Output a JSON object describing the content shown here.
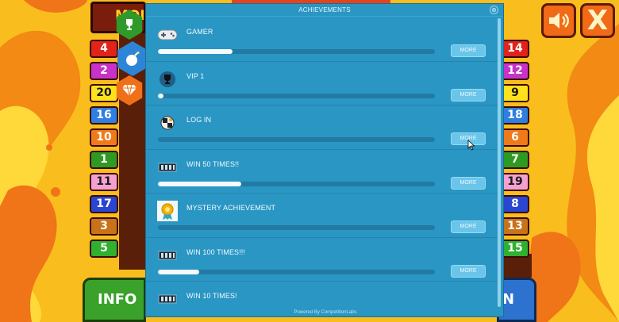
{
  "game": {
    "banner_label": "MONE",
    "info_label": "INFO",
    "spin_label": "N",
    "left_numbers": [
      {
        "value": "4",
        "color": "#e2231a",
        "dark": false
      },
      {
        "value": "2",
        "color": "#c832c8",
        "dark": false
      },
      {
        "value": "20",
        "color": "#ffe21c",
        "dark": true
      },
      {
        "value": "16",
        "color": "#2f7fe0",
        "dark": false
      },
      {
        "value": "10",
        "color": "#f07a1a",
        "dark": false
      },
      {
        "value": "1",
        "color": "#2e9a22",
        "dark": false
      },
      {
        "value": "11",
        "color": "#f5a0d0",
        "dark": true
      },
      {
        "value": "17",
        "color": "#2a46d0",
        "dark": false
      },
      {
        "value": "3",
        "color": "#c8721a",
        "dark": false
      },
      {
        "value": "5",
        "color": "#2fb02f",
        "dark": false
      }
    ],
    "right_numbers": [
      {
        "value": "14",
        "color": "#e2231a",
        "dark": false
      },
      {
        "value": "12",
        "color": "#c832c8",
        "dark": false
      },
      {
        "value": "9",
        "color": "#ffe21c",
        "dark": true
      },
      {
        "value": "18",
        "color": "#2f7fe0",
        "dark": false
      },
      {
        "value": "6",
        "color": "#f07a1a",
        "dark": false
      },
      {
        "value": "7",
        "color": "#2e9a22",
        "dark": false
      },
      {
        "value": "19",
        "color": "#f5a0d0",
        "dark": true
      },
      {
        "value": "8",
        "color": "#2a46d0",
        "dark": false
      },
      {
        "value": "13",
        "color": "#c8721a",
        "dark": false
      },
      {
        "value": "15",
        "color": "#2fb02f",
        "dark": false
      }
    ]
  },
  "modal": {
    "title": "ACHIEVEMENTS",
    "close_glyph": "⊗",
    "footer": "Powered By CompetitionLabs",
    "more_label": "MORE",
    "achievements": [
      {
        "name": "GAMER",
        "progress": 0.27,
        "icon": "gamepad-icon"
      },
      {
        "name": "VIP 1",
        "progress": 0.02,
        "icon": "trophy-icon"
      },
      {
        "name": "LOG IN",
        "progress": 0.0,
        "icon": "login-icon"
      },
      {
        "name": "WIN 50 TIMES!!",
        "progress": 0.3,
        "icon": "cash-icon"
      },
      {
        "name": "MYSTERY ACHIEVEMENT",
        "progress": 0.0,
        "icon": "mystery-badge-icon"
      },
      {
        "name": "WIN 100 TIMES!!!",
        "progress": 0.15,
        "icon": "cash-icon"
      },
      {
        "name": "WIN 10 TIMES!",
        "progress": 0.0,
        "icon": "cash-icon"
      }
    ]
  }
}
